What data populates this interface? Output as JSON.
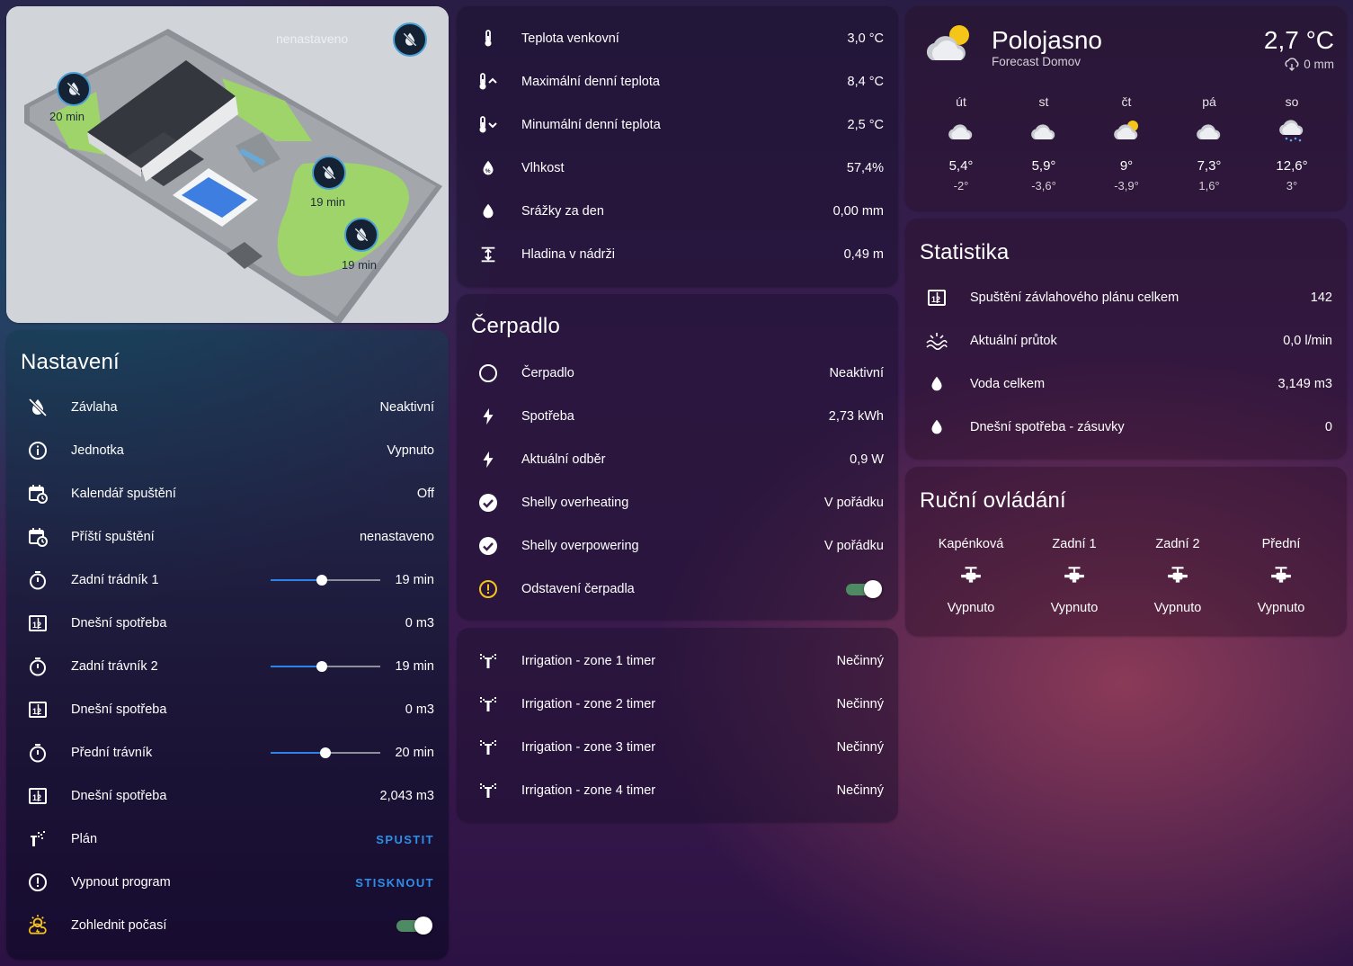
{
  "map": {
    "status_label": "nenastaveno",
    "zone_labels": [
      "20 min",
      "19 min",
      "19 min"
    ]
  },
  "settings": {
    "title": "Nastavení",
    "rows": [
      {
        "icon": "water-off-icon",
        "label": "Závlaha",
        "value": "Neaktivní"
      },
      {
        "icon": "info-icon",
        "label": "Jednotka",
        "value": "Vypnuto"
      },
      {
        "icon": "calendar-clock-icon",
        "label": "Kalendář spuštění",
        "value": "Off"
      },
      {
        "icon": "calendar-clock-icon",
        "label": "Příští spuštění",
        "value": "nenastaveno"
      },
      {
        "icon": "timer-icon",
        "label": "Zadní trádník 1",
        "value": "19 min",
        "slider": 0.47
      },
      {
        "icon": "counter-icon",
        "label": "Dnešní spotřeba",
        "value": "0 m3"
      },
      {
        "icon": "timer-icon",
        "label": "Zadní trávník 2",
        "value": "19 min",
        "slider": 0.47
      },
      {
        "icon": "counter-icon",
        "label": "Dnešní spotřeba",
        "value": "0 m3"
      },
      {
        "icon": "timer-icon",
        "label": "Přední trávník",
        "value": "20 min",
        "slider": 0.5
      },
      {
        "icon": "counter-icon",
        "label": "Dnešní spotřeba",
        "value": "2,043 m3"
      },
      {
        "icon": "sprinkler-icon",
        "label": "Plán",
        "button": "SPUSTIT"
      },
      {
        "icon": "alert-circle-icon",
        "label": "Vypnout program",
        "button": "STISKNOUT"
      },
      {
        "icon": "weather-alert-icon",
        "label": "Zohlednit počasí",
        "toggle": true
      }
    ]
  },
  "sensors": {
    "rows": [
      {
        "icon": "thermometer-icon",
        "label": "Teplota venkovní",
        "value": "3,0 °C"
      },
      {
        "icon": "thermometer-up-icon",
        "label": "Maximální denní teplota",
        "value": "8,4 °C"
      },
      {
        "icon": "thermometer-down-icon",
        "label": "Minumální denní teplota",
        "value": "2,5 °C"
      },
      {
        "icon": "humidity-icon",
        "label": "Vlhkost",
        "value": "57,4%"
      },
      {
        "icon": "water-drop-icon",
        "label": "Srážky za den",
        "value": "0,00 mm"
      },
      {
        "icon": "level-icon",
        "label": "Hladina v nádrži",
        "value": "0,49 m"
      }
    ]
  },
  "pump": {
    "title": "Čerpadlo",
    "rows": [
      {
        "icon": "circle-outline-icon",
        "label": "Čerpadlo",
        "value": "Neaktivní"
      },
      {
        "icon": "lightning-icon",
        "label": "Spotřeba",
        "value": "2,73 kWh"
      },
      {
        "icon": "lightning-icon",
        "label": "Aktuální odběr",
        "value": "0,9 W"
      },
      {
        "icon": "check-circle-icon",
        "label": "Shelly overheating",
        "value": "V pořádku"
      },
      {
        "icon": "check-circle-icon",
        "label": "Shelly overpowering",
        "value": "V pořádku"
      },
      {
        "icon": "alert-circle-yellow-icon",
        "label": "Odstavení čerpadla",
        "toggle": true
      }
    ]
  },
  "timers": {
    "rows": [
      {
        "label": "Irrigation - zone 1 timer",
        "value": "Nečinný"
      },
      {
        "label": "Irrigation - zone 2 timer",
        "value": "Nečinný"
      },
      {
        "label": "Irrigation - zone 3 timer",
        "value": "Nečinný"
      },
      {
        "label": "Irrigation - zone 4 timer",
        "value": "Nečinný"
      }
    ]
  },
  "weather": {
    "condition": "Polojasno",
    "source": "Forecast Domov",
    "temperature": "2,7 °C",
    "precipitation": "0 mm",
    "forecast": [
      {
        "day": "út",
        "icon": "cloudy-icon",
        "high": "5,4°",
        "low": "-2°"
      },
      {
        "day": "st",
        "icon": "cloudy-icon",
        "high": "5,9°",
        "low": "-3,6°"
      },
      {
        "day": "čt",
        "icon": "partly-cloudy-icon",
        "high": "9°",
        "low": "-3,9°"
      },
      {
        "day": "pá",
        "icon": "cloudy-icon",
        "high": "7,3°",
        "low": "1,6°"
      },
      {
        "day": "so",
        "icon": "rainy-icon",
        "high": "12,6°",
        "low": "3°"
      }
    ]
  },
  "stats": {
    "title": "Statistika",
    "rows": [
      {
        "icon": "counter-icon",
        "label": "Spuštění závlahového plánu celkem",
        "value": "142"
      },
      {
        "icon": "flow-icon",
        "label": "Aktuální průtok",
        "value": "0,0 l/min"
      },
      {
        "icon": "water-drop-icon",
        "label": "Voda celkem",
        "value": "3,149 m3"
      },
      {
        "icon": "water-drop-icon",
        "label": "Dnešní spotřeba - zásuvky",
        "value": "0"
      }
    ]
  },
  "manual": {
    "title": "Ruční ovládání",
    "items": [
      {
        "name": "Kapénková",
        "state": "Vypnuto"
      },
      {
        "name": "Zadní 1",
        "state": "Vypnuto"
      },
      {
        "name": "Zadní 2",
        "state": "Vypnuto"
      },
      {
        "name": "Přední",
        "state": "Vypnuto"
      }
    ]
  },
  "colors": {
    "accent": "#2f8fe8",
    "toggle_on": "#4e8b62",
    "warning": "#f5c518",
    "grass": "#9fd46a"
  }
}
